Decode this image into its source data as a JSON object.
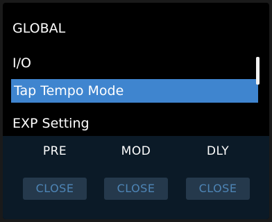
{
  "menu": {
    "items": [
      {
        "label": "GLOBAL"
      },
      {
        "label": "I/O"
      },
      {
        "label": "Tap Tempo Mode",
        "selected": true
      },
      {
        "label": "EXP Setting"
      }
    ],
    "scroll_position": 0.1
  },
  "effects": [
    {
      "header": "PRE",
      "button": "CLOSE"
    },
    {
      "header": "MOD",
      "button": "CLOSE"
    },
    {
      "header": "DLY",
      "button": "CLOSE"
    }
  ],
  "colors": {
    "selected_bg": "#3f85cf",
    "panel_bg": "#0b1a27",
    "button_bg": "#25394c",
    "button_text": "#4e85b6",
    "text": "#ffffff"
  }
}
